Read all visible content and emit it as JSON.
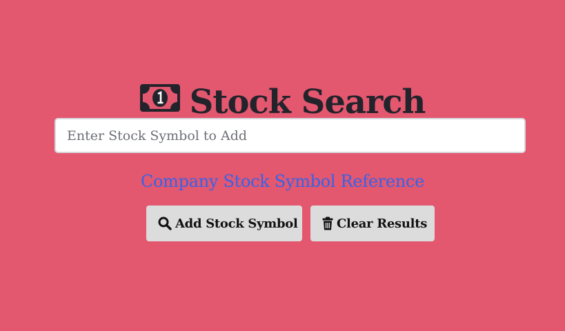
{
  "header": {
    "title": "Stock Search",
    "icon": "money-bill-icon"
  },
  "search": {
    "placeholder": "Enter Stock Symbol to Add",
    "value": ""
  },
  "reference_link": {
    "label": "Company Stock Symbol Reference"
  },
  "buttons": {
    "add": {
      "label": "Add Stock Symbol",
      "icon": "search-icon"
    },
    "clear": {
      "label": "Clear Results",
      "icon": "trash-icon"
    }
  },
  "colors": {
    "background": "#e3576f",
    "title": "#23232b",
    "link": "#3563e9",
    "button_bg": "#dcdcdc"
  }
}
